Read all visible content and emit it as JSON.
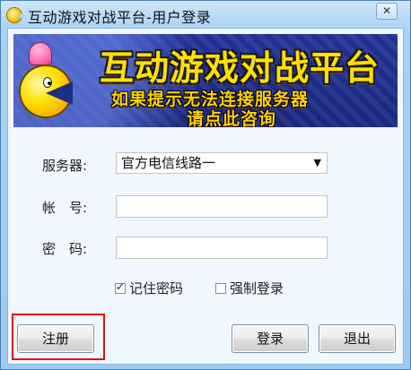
{
  "window": {
    "title": "互动游戏对战平台-用户登录",
    "close_symbol": "✕"
  },
  "banner": {
    "title": "互动游戏对战平台",
    "subtitle_line1": "如果提示无法连接服务器",
    "subtitle_line2": "请点此咨询"
  },
  "form": {
    "server_label": "服务器:",
    "server_value": "官方电信线路一",
    "account_label": "帐　号:",
    "account_value": "",
    "password_label": "密　码:",
    "password_value": "",
    "remember_label": "记住密码",
    "remember_checked": true,
    "force_label": "强制登录",
    "force_checked": false
  },
  "buttons": {
    "register": "注册",
    "login": "登录",
    "exit": "退出"
  },
  "colors": {
    "highlight": "#e01010",
    "banner_bg": "#1d2e86",
    "banner_text": "#ffe000"
  }
}
